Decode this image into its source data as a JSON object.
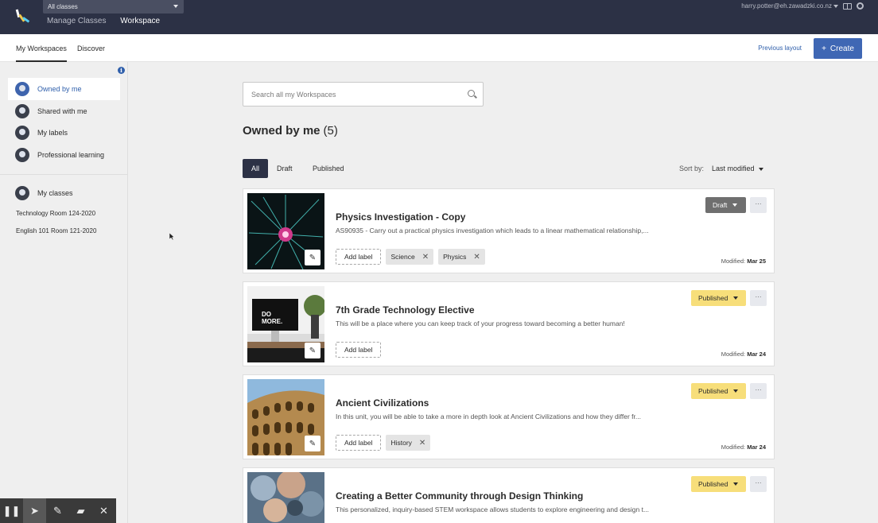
{
  "topbar": {
    "class_selector": "All classes",
    "nav": [
      "Manage Classes",
      "Workspace"
    ],
    "user_email": "harry.potter@eh.zawadzki.co.nz"
  },
  "subbar": {
    "tabs": [
      "My Workspaces",
      "Discover"
    ],
    "previous_layout": "Previous layout",
    "create_label": "Create",
    "create_icon": "+"
  },
  "sidebar": {
    "items": [
      {
        "label": "Owned by me",
        "icon": "user-icon"
      },
      {
        "label": "Shared with me",
        "icon": "users-icon"
      },
      {
        "label": "My labels",
        "icon": "label-icon"
      },
      {
        "label": "Professional learning",
        "icon": "graduation-cap-icon"
      },
      {
        "label": "My classes",
        "icon": "classroom-icon"
      }
    ],
    "classes": [
      "Technology Room 124-2020",
      "English 101 Room 121-2020"
    ]
  },
  "main": {
    "search_placeholder": "Search all my Workspaces",
    "heading": "Owned by me",
    "count": "(5)",
    "filters": [
      "All",
      "Draft",
      "Published"
    ],
    "sort_label": "Sort by:",
    "sort_value": "Last modified",
    "modified_label": "Modified:",
    "add_label": "Add label",
    "more": "···",
    "cards": [
      {
        "title": "Physics Investigation - Copy",
        "desc": "AS90935 - Carry out a practical physics investigation which leads to a linear mathematical relationship,...",
        "status": "Draft",
        "tags": [
          "Science",
          "Physics"
        ],
        "modified": "Mar 25"
      },
      {
        "title": "7th Grade Technology Elective",
        "desc": "This will be a place where you can keep track of your progress toward becoming a better human!",
        "status": "Published",
        "tags": [],
        "modified": "Mar 24"
      },
      {
        "title": "Ancient Civilizations",
        "desc": "In this unit, you will be able to take a more in depth look at Ancient Civilizations and how they differ fr...",
        "status": "Published",
        "tags": [
          "History"
        ],
        "modified": "Mar 24"
      },
      {
        "title": "Creating a Better Community through Design Thinking",
        "desc": "This personalized, inquiry-based STEM workspace allows students to explore engineering and design t...",
        "status": "Published",
        "tags": [],
        "modified": ""
      }
    ]
  },
  "colors": {
    "topbar": "#2c3145",
    "accent": "#3f67b4",
    "published": "#f7de7a",
    "draft": "#6f6f6f"
  }
}
